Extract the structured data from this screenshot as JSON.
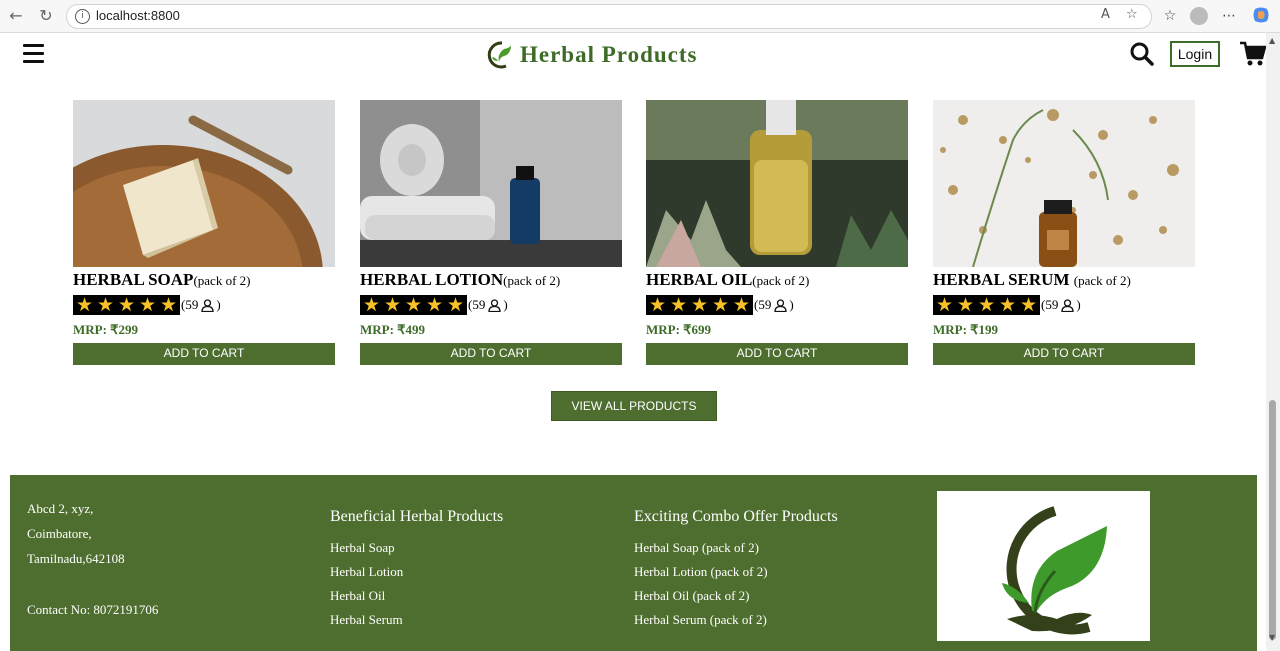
{
  "browser": {
    "url": "localhost:8800"
  },
  "header": {
    "brand": "Herbal Products",
    "login_label": "Login"
  },
  "products": [
    {
      "name": "HERBAL SOAP",
      "pack": "(pack of 2)",
      "rating_stars": 5,
      "reviews": "(59",
      "reviews_close": ")",
      "mrp": "MRP: ₹299",
      "cta": "ADD TO CART",
      "image": "soap-image"
    },
    {
      "name": "HERBAL LOTION",
      "pack": "(pack of 2)",
      "rating_stars": 5,
      "reviews": "(59",
      "reviews_close": ")",
      "mrp": "MRP: ₹499",
      "cta": "ADD TO CART",
      "image": "lotion-image"
    },
    {
      "name": "HERBAL OIL",
      "pack": "(pack of 2)",
      "rating_stars": 5,
      "reviews": "(59",
      "reviews_close": ")",
      "mrp": "MRP: ₹699",
      "cta": "ADD TO CART",
      "image": "oil-image"
    },
    {
      "name": "HERBAL SERUM ",
      "pack": "(pack of 2)",
      "rating_stars": 5,
      "reviews": "(59",
      "reviews_close": ")",
      "mrp": "MRP: ₹199",
      "cta": "ADD TO CART",
      "image": "serum-image"
    }
  ],
  "view_all_label": "VIEW ALL PRODUCTS",
  "footer": {
    "address": [
      "Abcd 2, xyz,",
      "Coimbatore,",
      "Tamilnadu,642108"
    ],
    "contact": "Contact No: 8072191706",
    "col1": {
      "title": "Beneficial Herbal Products",
      "links": [
        "Herbal Soap",
        "Herbal Lotion",
        "Herbal Oil",
        "Herbal Serum"
      ]
    },
    "col2": {
      "title": "Exciting Combo Offer Products",
      "links": [
        "Herbal Soap (pack of 2)",
        "Herbal Lotion (pack of 2)",
        "Herbal Oil (pack of 2)",
        "Herbal Serum (pack of 2)"
      ]
    }
  },
  "colors": {
    "brand_green": "#3e6b27",
    "button_green": "#4e6e30",
    "star_yellow": "#f7c12a"
  }
}
